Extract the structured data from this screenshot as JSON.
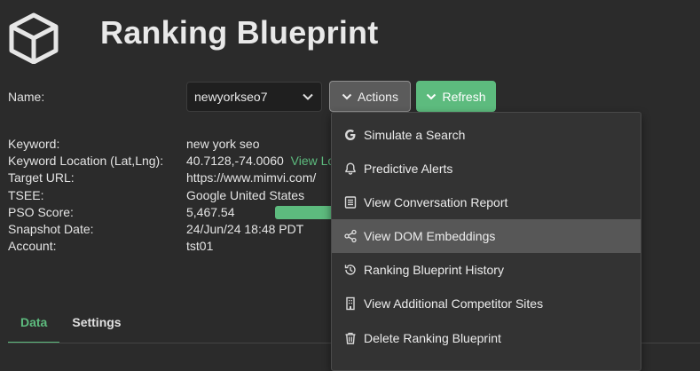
{
  "app": {
    "title": "Ranking Blueprint"
  },
  "name_field": {
    "label": "Name:",
    "value": "newyorkseo7"
  },
  "buttons": {
    "actions": "Actions",
    "refresh": "Refresh"
  },
  "details": {
    "keyword": {
      "label": "Keyword:",
      "value": "new york seo"
    },
    "location": {
      "label": "Keyword Location (Lat,Lng):",
      "value": "40.7128,-74.0060",
      "link": "View Lo"
    },
    "target_url": {
      "label": "Target URL:",
      "value": "https://www.mimvi.com/"
    },
    "tsee": {
      "label": "TSEE:",
      "value": "Google United States"
    },
    "pso": {
      "label": "PSO Score:",
      "value": "5,467.54",
      "progress": 0.8
    },
    "snapshot": {
      "label": "Snapshot Date:",
      "value": "24/Jun/24 18:48 PDT"
    },
    "account": {
      "label": "Account:",
      "value": "tst01"
    }
  },
  "tabs": [
    {
      "label": "Data",
      "active": true
    },
    {
      "label": "Settings",
      "active": false
    }
  ],
  "menu": {
    "items": [
      {
        "label": "Simulate a Search",
        "icon": "google-icon"
      },
      {
        "label": "Predictive Alerts",
        "icon": "bell-icon"
      },
      {
        "label": "View Conversation Report",
        "icon": "report-icon"
      },
      {
        "label": "View DOM Embeddings",
        "icon": "share-nodes-icon",
        "highlighted": true
      },
      {
        "label": "Ranking Blueprint History",
        "icon": "history-icon"
      },
      {
        "label": "View Additional Competitor Sites",
        "icon": "building-icon"
      },
      {
        "label": "Delete Ranking Blueprint",
        "icon": "trash-icon"
      }
    ]
  },
  "colors": {
    "background": "#2b2b2b",
    "accent": "#5dbb7e",
    "menu_highlight": "#575757"
  }
}
